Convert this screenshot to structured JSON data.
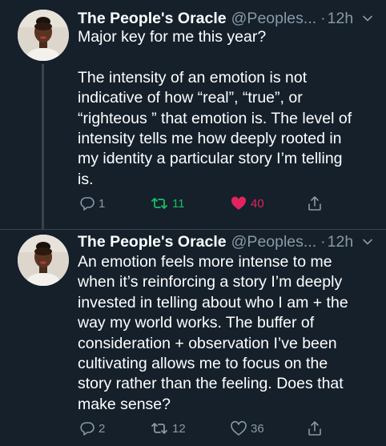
{
  "colors": {
    "background": "#15202b",
    "text": "#ffffff",
    "secondary": "#8899a6",
    "retweet_active": "#17bf63",
    "like_active": "#e0245e",
    "divider": "#38444d"
  },
  "tweets": [
    {
      "author_name": "The People's Oracle",
      "handle": "@Peoples...",
      "separator": "·",
      "time": "12h",
      "body_lines": [
        "Major key for me this year?",
        "",
        "The intensity of an emotion is not",
        "indicative of how “real”, “true”, or",
        "“righteous ” that emotion is. The level of",
        "intensity tells me how deeply rooted in",
        "my identity a particular story I’m telling",
        "is."
      ],
      "replies": "1",
      "retweets": "11",
      "likes": "40",
      "retweeted": true,
      "liked": true,
      "icons": [
        "reply-icon",
        "retweet-icon",
        "heart-icon",
        "share-icon",
        "chevron-down-icon"
      ]
    },
    {
      "author_name": "The People's Oracle",
      "handle": "@Peoples...",
      "separator": "·",
      "time": "12h",
      "body_lines": [
        "An emotion feels more intense to me",
        "when it’s reinforcing a story I’m deeply",
        "invested in telling about who I am + the",
        "way my world works. The buffer of",
        "consideration + observation I’ve been",
        "cultivating allows me to focus on the",
        "story rather than the feeling. Does that",
        "make sense?"
      ],
      "replies": "2",
      "retweets": "12",
      "likes": "36",
      "retweeted": false,
      "liked": false,
      "icons": [
        "reply-icon",
        "retweet-icon",
        "heart-icon",
        "share-icon",
        "chevron-down-icon"
      ]
    }
  ]
}
